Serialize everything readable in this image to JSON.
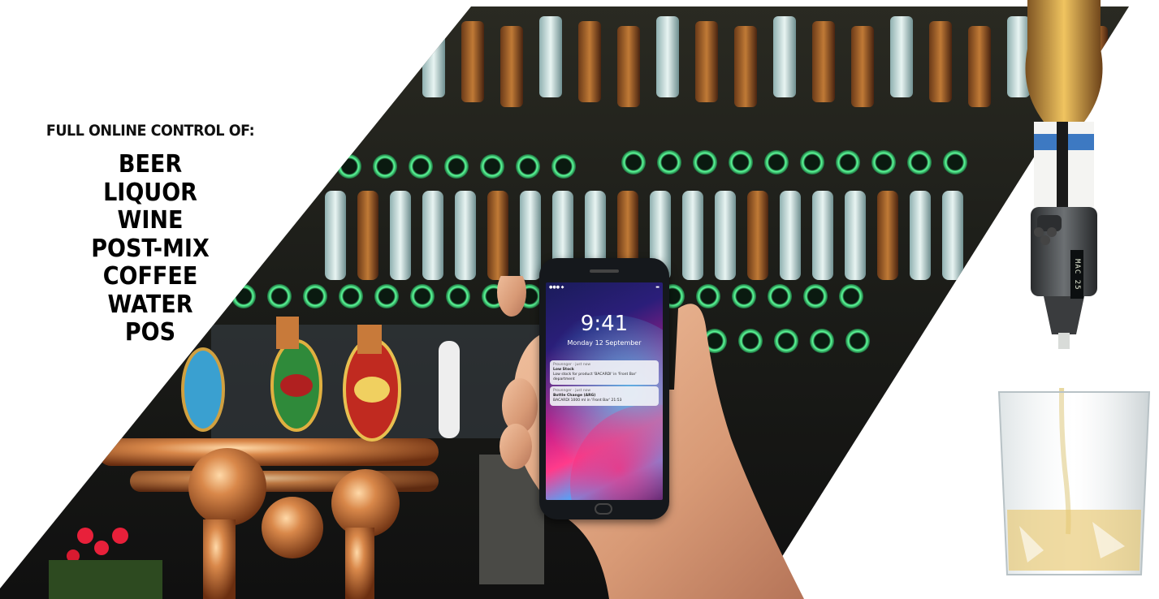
{
  "promo": {
    "heading": "FULL ONLINE CONTROL OF:",
    "items": [
      "BEER",
      "LIQUOR",
      "WINE",
      "POST-MIX",
      "COFFEE",
      "WATER",
      "POS"
    ]
  },
  "phone": {
    "status_left": "●●● ◆",
    "status_right": "▬",
    "time": "9:41",
    "date": "Monday 12 September",
    "notifications": [
      {
        "app": "Provenger · just now",
        "title": "Low Stock",
        "body": "Low stock for product 'BACARDI' in 'Front Bar' department"
      },
      {
        "app": "Provenger · just now",
        "title": "Bottle Change (ARG)",
        "body": "BACARDI 1000 ml in 'Front Bar' 21:53"
      }
    ]
  },
  "dispenser": {
    "display": "MAC 25"
  },
  "colors": {
    "bar_dark": "#15140f",
    "tap_copper": "#c8783a",
    "led_green": "#36e07a",
    "phone_body": "#15181c"
  },
  "images": [
    "bar-liquor-wall-photo",
    "beer-taps-photo",
    "smartphone-lockscreen-photo",
    "hand-photo",
    "smart-pourer-dispenser-photo",
    "glass-pour-photo"
  ]
}
